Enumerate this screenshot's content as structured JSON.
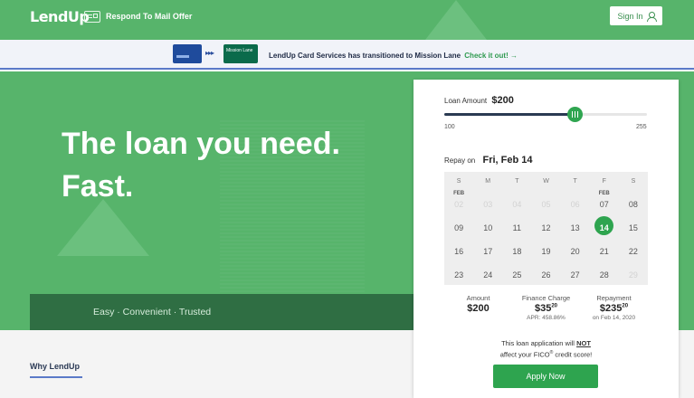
{
  "header": {
    "logo": "LendUp",
    "respond_link": "Respond To Mail Offer",
    "signin_label": "Sign In"
  },
  "banner": {
    "card_label": "Mission Lane",
    "text": "LendUp Card Services has transitioned to Mission Lane",
    "link": "Check it out! →"
  },
  "hero": {
    "title": "The loan you need. Fast.",
    "tagline": "Easy · Convenient · Trusted"
  },
  "bottom": {
    "why_link": "Why LendUp"
  },
  "loan": {
    "amount_label": "Loan Amount",
    "amount_value": "$200",
    "slider_min": "100",
    "slider_max": "255",
    "slider_position": 0.645,
    "repay_label": "Repay on",
    "repay_date": "Fri, Feb 14",
    "weekdays": [
      "S",
      "M",
      "T",
      "W",
      "T",
      "F",
      "S"
    ],
    "calendar": [
      {
        "month": "FEB",
        "day": "02",
        "disabled": true
      },
      {
        "day": "03",
        "disabled": true
      },
      {
        "day": "04",
        "disabled": true
      },
      {
        "day": "05",
        "disabled": true
      },
      {
        "day": "06",
        "disabled": true
      },
      {
        "month": "FEB",
        "day": "07"
      },
      {
        "day": "08"
      },
      {
        "day": "09"
      },
      {
        "day": "10"
      },
      {
        "day": "11"
      },
      {
        "day": "12"
      },
      {
        "day": "13"
      },
      {
        "day": "14",
        "selected": true
      },
      {
        "day": "15"
      },
      {
        "day": "16"
      },
      {
        "day": "17"
      },
      {
        "day": "18"
      },
      {
        "day": "19"
      },
      {
        "day": "20"
      },
      {
        "day": "21"
      },
      {
        "day": "22"
      },
      {
        "day": "23"
      },
      {
        "day": "24"
      },
      {
        "day": "25"
      },
      {
        "day": "26"
      },
      {
        "day": "27"
      },
      {
        "day": "28"
      },
      {
        "day": "29",
        "disabled": true
      }
    ],
    "summary": {
      "amount_label": "Amount",
      "amount_value": "$200",
      "finance_label": "Finance Charge",
      "finance_value": "$35",
      "finance_cents": "20",
      "apr": "APR: 458.86%",
      "repayment_label": "Repayment",
      "repayment_value": "$235",
      "repayment_cents": "20",
      "repayment_date": "on Feb 14, 2020"
    },
    "note_line1_pre": "This loan application will ",
    "note_not": "NOT",
    "note_line2_pre": "affect your FICO",
    "note_reg": "®",
    "note_line2_post": " credit score!",
    "apply_label": "Apply Now"
  },
  "colors": {
    "brand_green": "#57b46b",
    "dark_green": "#2f6e43",
    "action_green": "#2ea44f",
    "banner_accent": "#5b7ac8"
  }
}
